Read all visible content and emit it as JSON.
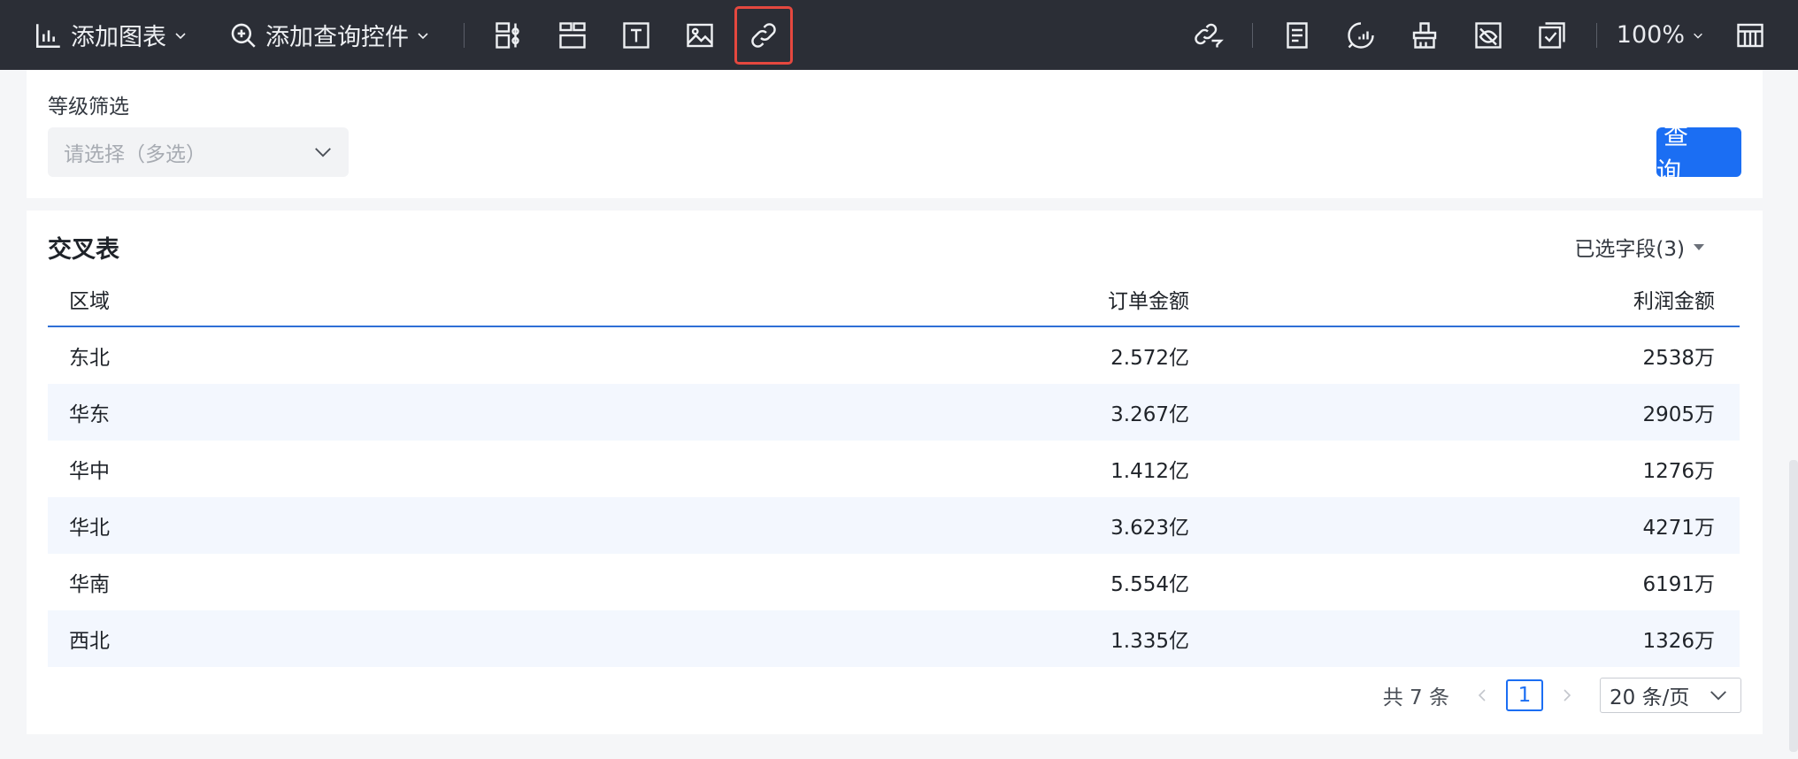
{
  "toolbar": {
    "add_chart": "添加图表",
    "add_query_control": "添加查询控件",
    "zoom": "100%",
    "icons": [
      "chart-bar-icon",
      "zoom-plus-icon",
      "layout-columns-icon",
      "layout-rows-icon",
      "text-box-icon",
      "image-icon",
      "link-icon",
      "link-filter-icon",
      "report-icon",
      "chat-analysis-icon",
      "brush-icon",
      "hide-eye-icon",
      "check-box-icon",
      "table-grid-icon"
    ]
  },
  "filter": {
    "label": "等级筛选",
    "placeholder": "请选择（多选）",
    "query_button": "查 询"
  },
  "table_card": {
    "title": "交叉表",
    "fields_selected": "已选字段(3)",
    "columns": [
      "区域",
      "订单金额",
      "利润金额"
    ],
    "rows": [
      [
        "东北",
        "2.572亿",
        "2538万"
      ],
      [
        "华东",
        "3.267亿",
        "2905万"
      ],
      [
        "华中",
        "1.412亿",
        "1276万"
      ],
      [
        "华北",
        "3.623亿",
        "4271万"
      ],
      [
        "华南",
        "5.554亿",
        "6191万"
      ],
      [
        "西北",
        "1.335亿",
        "1326万"
      ]
    ],
    "pager": {
      "total": "共 7 条",
      "current_page": "1",
      "page_size": "20 条/页"
    }
  },
  "colors": {
    "toolbar_bg": "#2b2e36",
    "accent": "#1b6ef3",
    "selected_outline": "#e5483f",
    "row_alt": "#f3f7fe"
  }
}
